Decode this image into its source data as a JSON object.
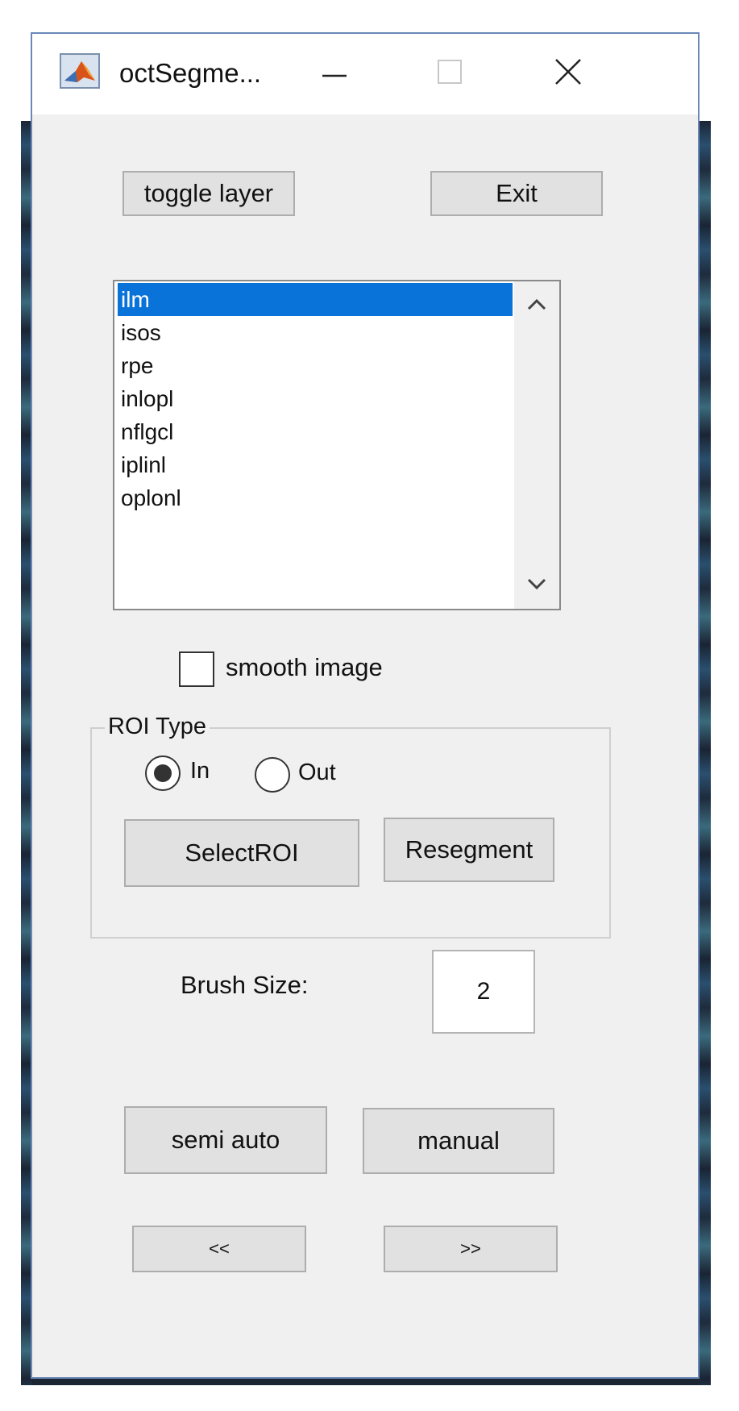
{
  "window": {
    "title": "octSegme...",
    "icon": "matlab-icon"
  },
  "window_controls": {
    "minimize_icon": "minimize-icon",
    "maximize_icon": "maximize-icon",
    "close_icon": "close-icon"
  },
  "toolbar": {
    "toggle_layer_label": "toggle layer",
    "exit_label": "Exit"
  },
  "layer_list": {
    "items": [
      "ilm",
      "isos",
      "rpe",
      "inlopl",
      "nflgcl",
      "iplinl",
      "oplonl"
    ],
    "selected": "ilm"
  },
  "smooth_image": {
    "label": "smooth image",
    "checked": false
  },
  "roi_type": {
    "title": "ROI Type",
    "in_label": "In",
    "out_label": "Out",
    "selected": "In",
    "select_roi_label": "SelectROI",
    "resegment_label": "Resegment"
  },
  "brush": {
    "label": "Brush Size:",
    "value": "2"
  },
  "mode": {
    "semi_auto_label": "semi auto",
    "manual_label": "manual"
  },
  "nav": {
    "prev_label": "<<",
    "next_label": ">>"
  },
  "colors": {
    "selection": "#0a73d9",
    "window_bg": "#f0f0f0",
    "button_bg": "#e1e1e1",
    "window_border": "#6b88b8"
  }
}
